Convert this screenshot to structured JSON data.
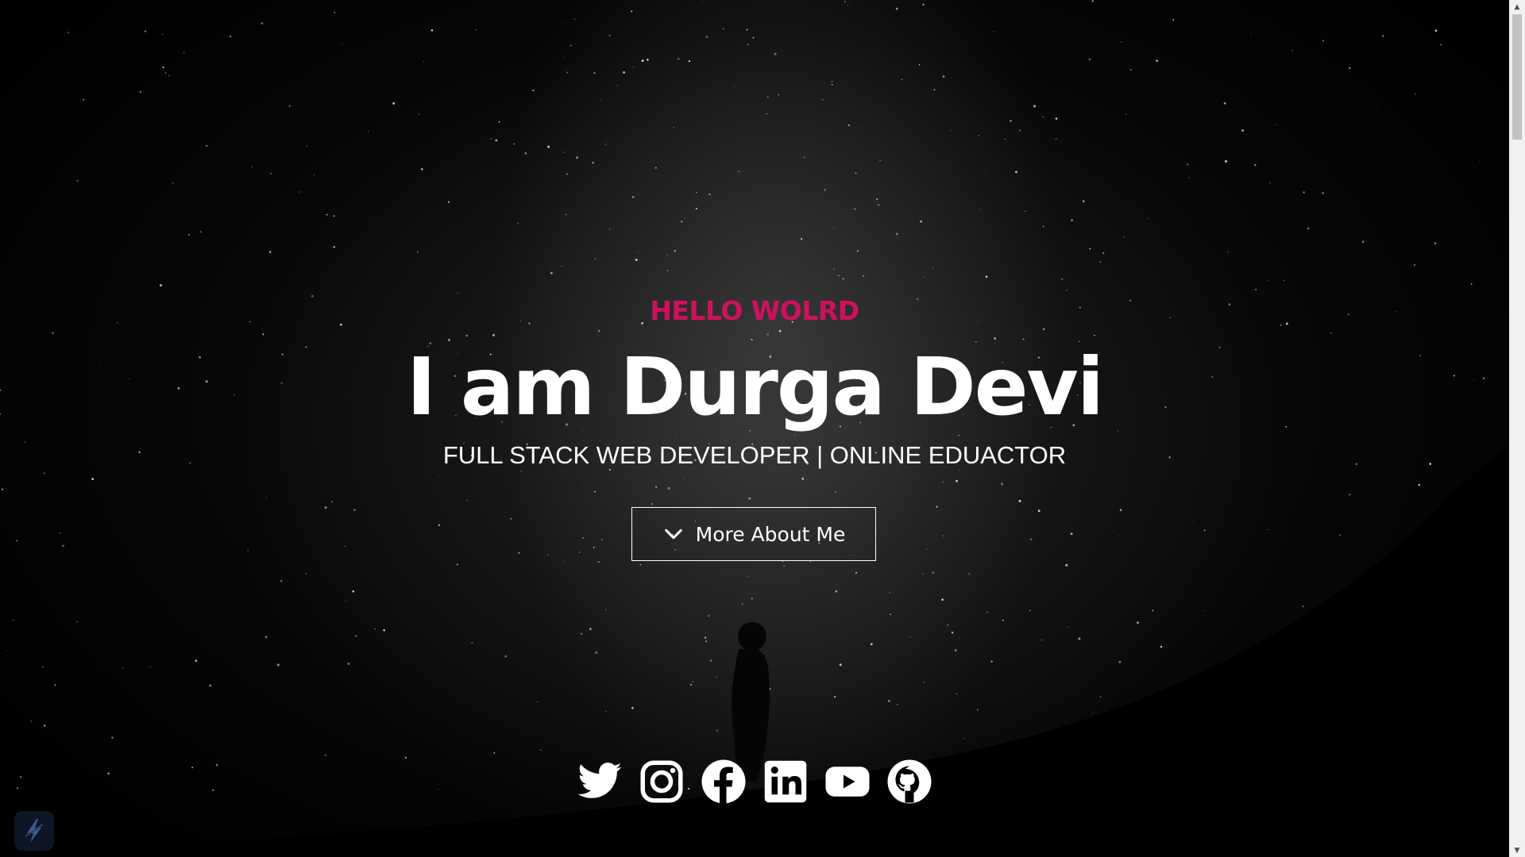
{
  "hero": {
    "kicker": "HELLO WOLRD",
    "name": "I am Durga Devi",
    "tagline": "FULL STACK WEB DEVELOPER | ONLINE EDUACTOR",
    "button_label": "More About Me"
  },
  "colors": {
    "accent": "#d0105f",
    "text": "#ffffff",
    "background": "#000000"
  },
  "socials": [
    {
      "icon": "twitter-icon"
    },
    {
      "icon": "instagram-icon"
    },
    {
      "icon": "facebook-icon"
    },
    {
      "icon": "linkedin-icon"
    },
    {
      "icon": "youtube-icon"
    },
    {
      "icon": "github-icon"
    }
  ],
  "scrollbar": {
    "up_arrow": "▲",
    "down_arrow": "▼"
  }
}
